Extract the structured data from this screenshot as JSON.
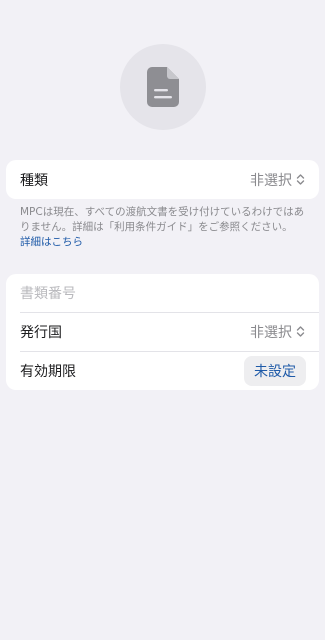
{
  "document_icon": "document-icon",
  "type_row": {
    "label": "種類",
    "value": "非選択",
    "icon": "chevron-updown-icon"
  },
  "footnote": {
    "text": "MPCは現在、すべての渡航文書を受け付けているわけではありません。詳細は「利用条件ガイド」をご参照ください。",
    "link": "詳細はこちら"
  },
  "document_form": {
    "number_placeholder": "書類番号",
    "country_label": "発行国",
    "country_value": "非選択",
    "country_icon": "chevron-updown-icon",
    "expiry_label": "有効期限",
    "expiry_button": "未設定"
  },
  "colors": {
    "background": "#f2f1f6",
    "accent": "#1e5aa8",
    "secondary_text": "#8a8a8e"
  }
}
